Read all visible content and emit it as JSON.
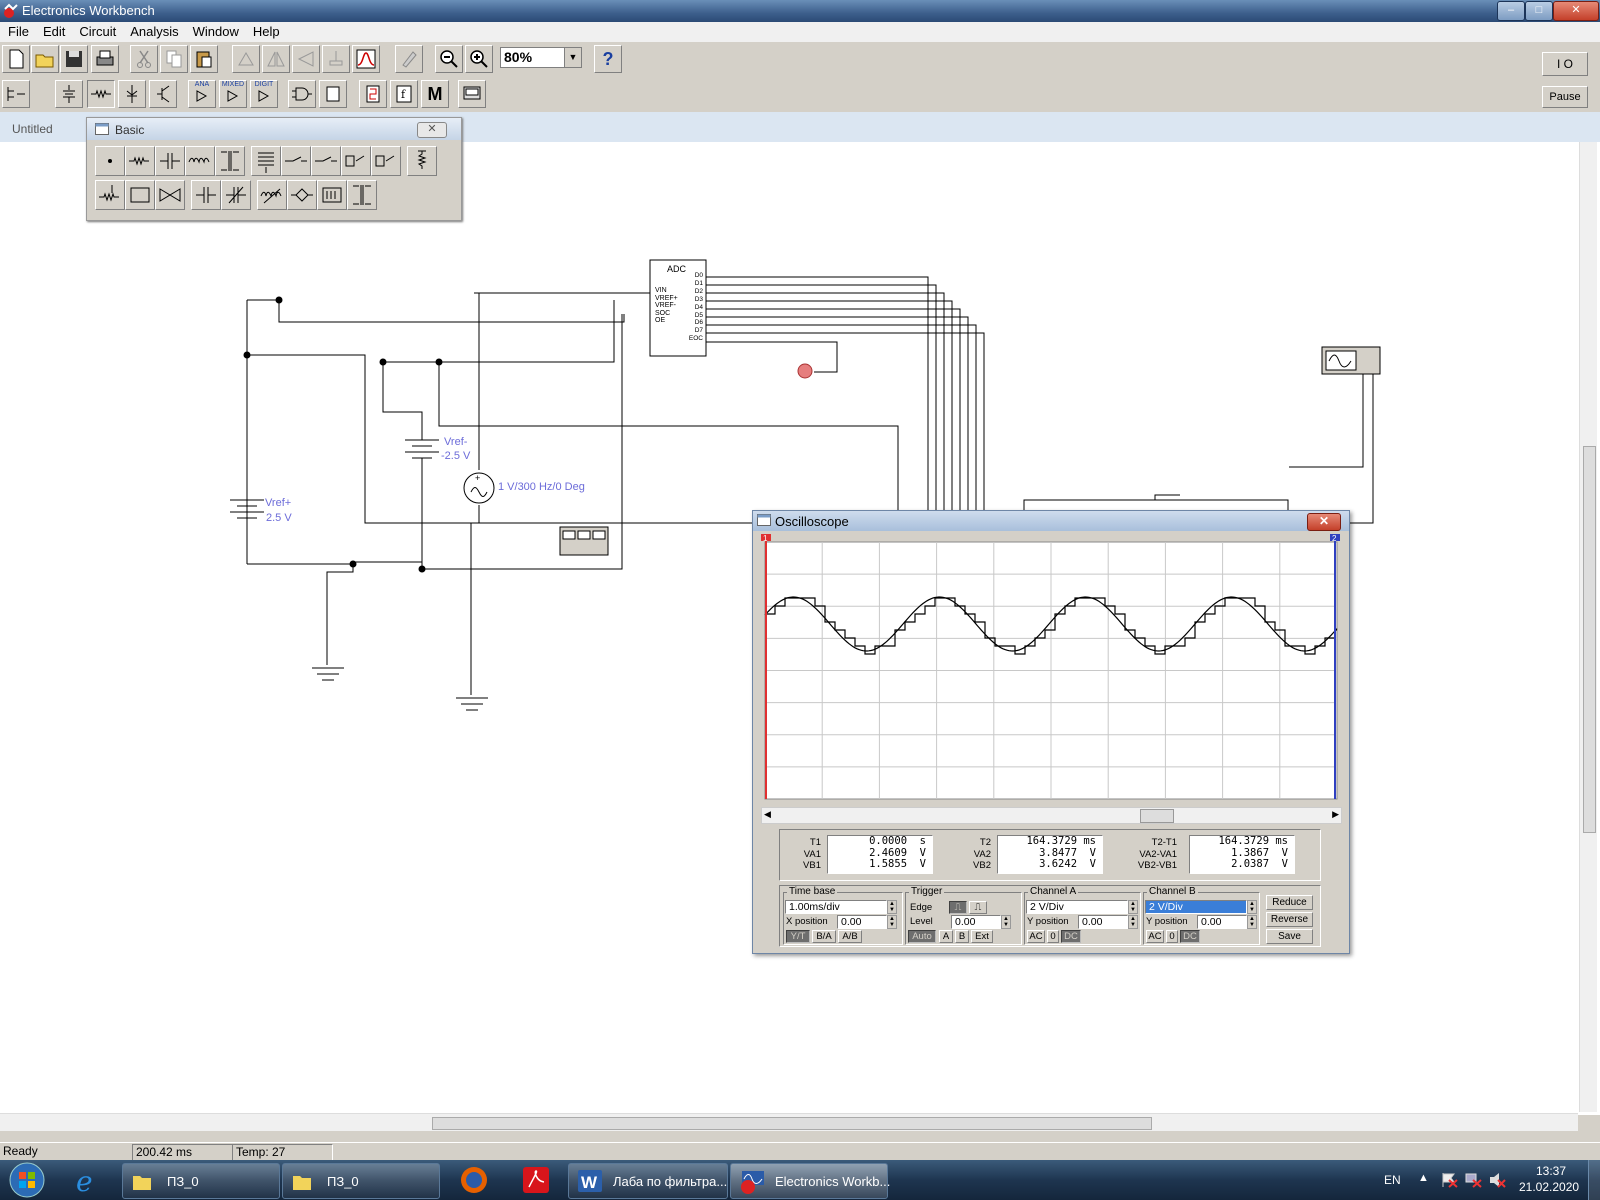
{
  "window": {
    "title": "Electronics Workbench",
    "controls": [
      "–",
      "□",
      "✕"
    ]
  },
  "menu": [
    "File",
    "Edit",
    "Circuit",
    "Analysis",
    "Window",
    "Help"
  ],
  "toolbar": {
    "zoom_value": "80%",
    "help_glyph": "?",
    "pause_label": "Pause",
    "power_label": "I O"
  },
  "toolbar2_labels": {
    "ana": "ANA",
    "mixed": "MIXED",
    "digit": "DIGIT",
    "misc": "M"
  },
  "document": {
    "tab": "Untitled"
  },
  "palette": {
    "title": "Basic",
    "close": "✕"
  },
  "circuit": {
    "adc_title": "ADC",
    "adc_inputs": [
      "VIN",
      "VREF+",
      "VREF-",
      "SOC",
      "OE"
    ],
    "adc_outputs": [
      "D0",
      "D1",
      "D2",
      "D3",
      "D4",
      "D5",
      "D6",
      "D7",
      "EOC"
    ],
    "vref_minus_name": "Vref-",
    "vref_minus_value": "-2.5 V",
    "vref_plus_name": "Vref+",
    "vref_plus_value": "2.5 V",
    "source_label": "1 V/300 Hz/0 Deg",
    "plus_sign": "+"
  },
  "oscilloscope": {
    "title": "Oscilloscope",
    "close": "✕",
    "marker1": "1",
    "marker2": "2",
    "readout": {
      "labels_left": [
        "T1",
        "VA1",
        "VB1"
      ],
      "values_left": [
        "0.0000  s",
        "2.4609  V",
        "1.5855  V"
      ],
      "labels_mid": [
        "T2",
        "VA2",
        "VB2"
      ],
      "values_mid": [
        "164.3729 ms",
        "3.8477  V",
        "3.6242  V"
      ],
      "labels_right": [
        "T2-T1",
        "VA2-VA1",
        "VB2-VB1"
      ],
      "values_right": [
        "164.3729 ms",
        "1.3867  V",
        "2.0387  V"
      ]
    },
    "timebase": {
      "label": "Time base",
      "value": "1.00ms/div",
      "xpos_label": "X position",
      "xpos": "0.00",
      "modes": [
        "Y/T",
        "B/A",
        "A/B"
      ]
    },
    "trigger": {
      "label": "Trigger",
      "edge_label": "Edge",
      "level_label": "Level",
      "level": "0.00",
      "sources": [
        "Auto",
        "A",
        "B",
        "Ext"
      ]
    },
    "channel_a": {
      "label": "Channel A",
      "scale": "2 V/Div",
      "ypos_label": "Y position",
      "ypos": "0.00",
      "coupling": [
        "AC",
        "0",
        "DC"
      ]
    },
    "channel_b": {
      "label": "Channel B",
      "scale": "2 V/Div",
      "ypos_label": "Y position",
      "ypos": "0.00",
      "coupling": [
        "AC",
        "0",
        "DC"
      ]
    },
    "buttons": [
      "Reduce",
      "Reverse",
      "Save"
    ]
  },
  "status": {
    "state": "Ready",
    "time": "200.42 ms",
    "temp": "Temp:  27"
  },
  "taskbar": {
    "items": [
      "ПЗ_0",
      "ПЗ_0",
      "Лаба по фильтра...",
      "Electronics Workb..."
    ],
    "lang": "EN",
    "clock_time": "13:37",
    "clock_date": "21.02.2020"
  }
}
